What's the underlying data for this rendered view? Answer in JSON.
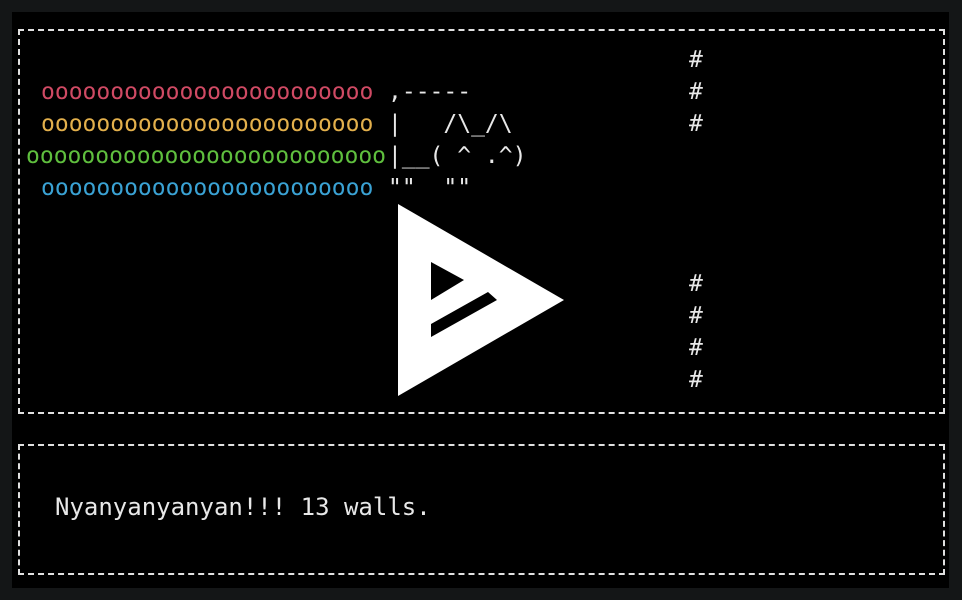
{
  "game": {
    "trail": {
      "row1": "oooooooooooooooooooooooo",
      "row2": "oooooooooooooooooooooooo",
      "row3": "oooooooooooooooooooooooooo",
      "row4": "oooooooooooooooooooooooo"
    },
    "cat": {
      "row1": ",-----",
      "row2": "|   /\\_/\\",
      "row3": "|__( ^ .^)",
      "row4": "\"\"  \"\""
    },
    "wall_char": "#",
    "colors": {
      "trail_red": "#d04a64",
      "trail_yellow": "#e3b04c",
      "trail_green": "#5fbf3e",
      "trail_blue": "#3aa2d4",
      "foreground": "#e8e8e8",
      "background": "#000000"
    }
  },
  "overlay": {
    "icon": "asciinema-play-icon"
  },
  "status": {
    "message": "Nyanyanyanyan!!! 13 walls."
  }
}
